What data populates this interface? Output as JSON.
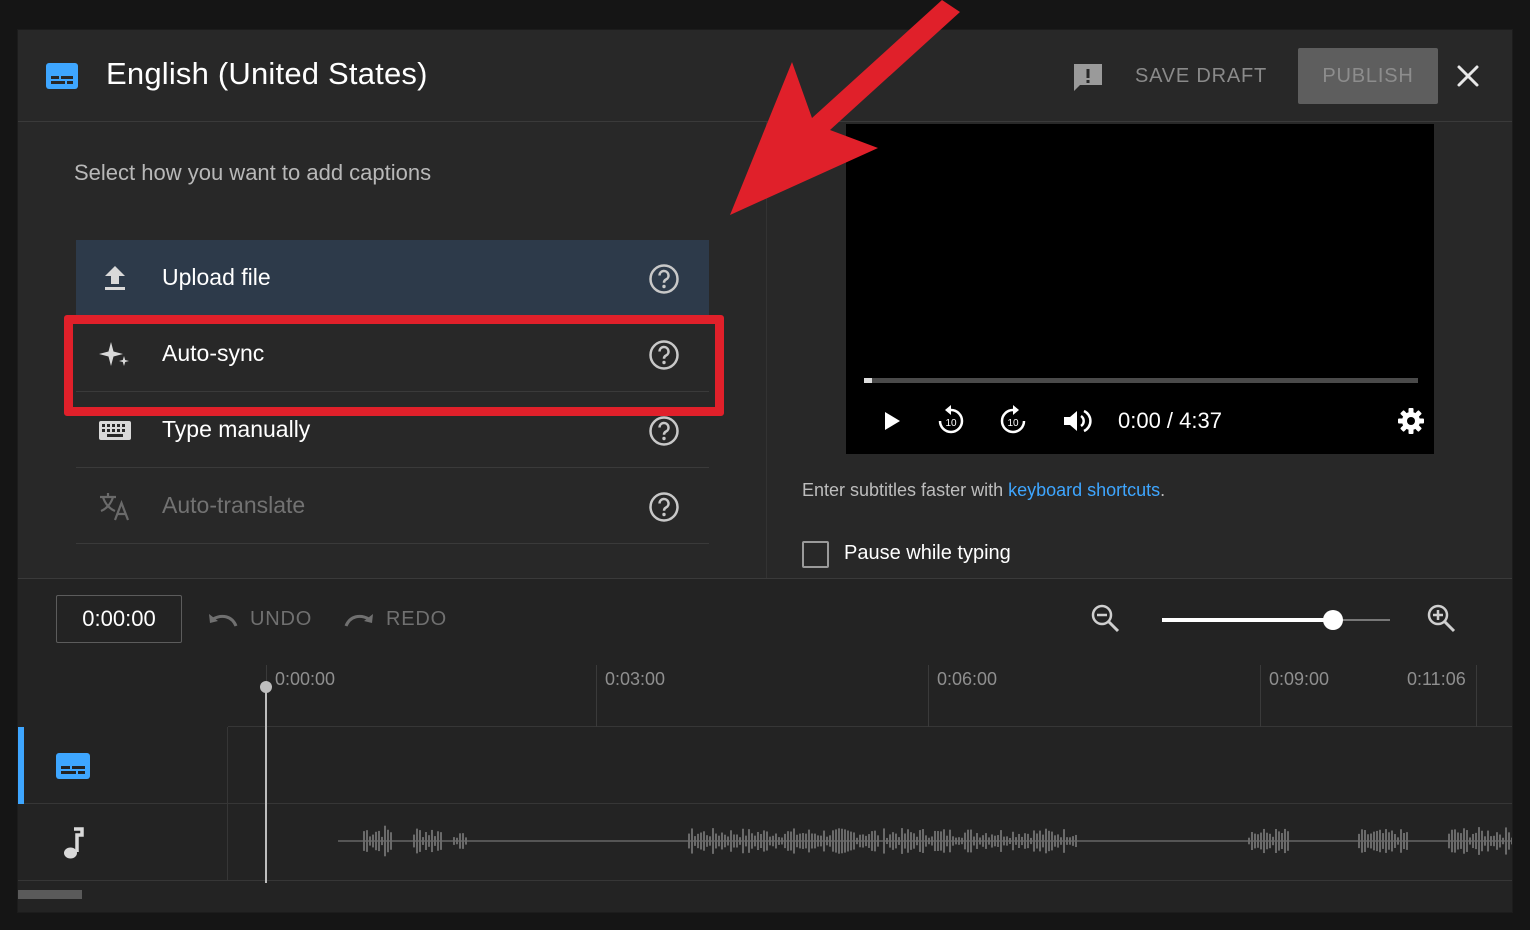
{
  "header": {
    "title": "English (United States)",
    "save_draft": "SAVE DRAFT",
    "publish": "PUBLISH"
  },
  "panel": {
    "instruction": "Select how you want to add captions",
    "options": [
      {
        "label": "Upload file",
        "icon": "upload-icon",
        "selected": true,
        "enabled": true
      },
      {
        "label": "Auto-sync",
        "icon": "sparkle-icon",
        "selected": false,
        "enabled": true
      },
      {
        "label": "Type manually",
        "icon": "keyboard-icon",
        "selected": false,
        "enabled": true
      },
      {
        "label": "Auto-translate",
        "icon": "translate-icon",
        "selected": false,
        "enabled": false
      }
    ]
  },
  "player": {
    "time": "0:00 / 4:37",
    "progress": 0.0
  },
  "hint": {
    "text": "Enter subtitles faster with ",
    "link": "keyboard shortcuts",
    "suffix": "."
  },
  "pause_while_typing": {
    "label": "Pause while typing",
    "checked": false
  },
  "timeline": {
    "timecode": "0:00:00",
    "undo": "UNDO",
    "redo": "REDO",
    "zoom_level": 0.75,
    "ruler": [
      "0:00:00",
      "0:03:00",
      "0:06:00",
      "0:09:00",
      "0:11:06"
    ]
  },
  "colors": {
    "accent": "#3ea6ff",
    "annotation_red": "#e0202a",
    "background": "#282828"
  }
}
